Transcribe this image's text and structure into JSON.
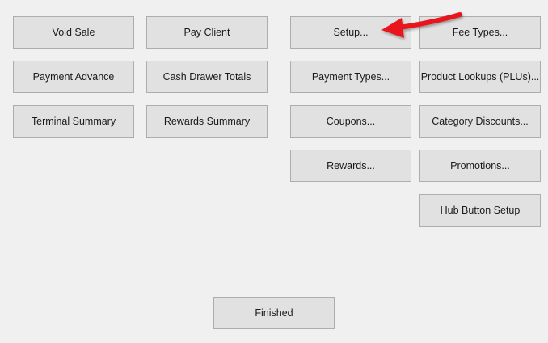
{
  "buttons": {
    "void_sale": "Void Sale",
    "pay_client": "Pay Client",
    "setup": "Setup...",
    "fee_types": "Fee Types...",
    "payment_advance": "Payment Advance",
    "cash_drawer_totals": "Cash Drawer Totals",
    "payment_types": "Payment Types...",
    "product_lookups": "Product Lookups (PLUs)...",
    "terminal_summary": "Terminal Summary",
    "rewards_summary": "Rewards Summary",
    "coupons": "Coupons...",
    "category_discounts": "Category Discounts...",
    "rewards": "Rewards...",
    "promotions": "Promotions...",
    "hub_button_setup": "Hub Button Setup",
    "finished": "Finished"
  },
  "annotation": {
    "icon": "red-arrow-icon",
    "color": "#e8171c"
  },
  "colors": {
    "background": "#f0f0f0",
    "button_face": "#e1e1e1",
    "button_border": "#adadad",
    "text": "#1a1a1a"
  }
}
